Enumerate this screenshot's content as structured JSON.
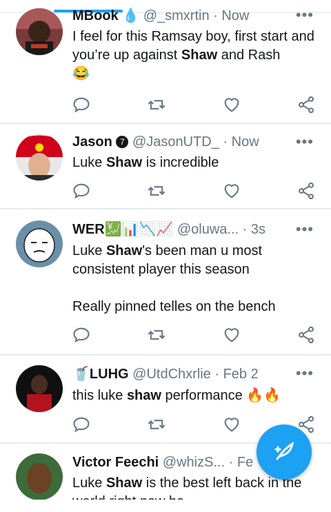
{
  "tweets": [
    {
      "name": "MBook",
      "handle_emoji": "💧",
      "handle": "@_smxrtin",
      "time": "· Now",
      "more": "•••",
      "text_before": "I feel for this Ramsay boy, first start and you’re up against ",
      "bold1": "Shaw",
      "text_mid": " and Rash",
      "emoji": "😂"
    },
    {
      "name": "Jason",
      "badge": "7",
      "handle": "@JasonUTD_",
      "time": "· Now",
      "more": "•••",
      "text_before": "Luke ",
      "bold1": "Shaw",
      "text_after": " is incredible"
    },
    {
      "name": "WER",
      "name_emoji": "💹📊📉📈",
      "handle": "@oluwa...",
      "time": "· 3s",
      "more": "•••",
      "text_before": "Luke ",
      "bold1": "Shaw",
      "text_after": "'s been man u most consistent player this season",
      "text_line2": "Really pinned telles on the bench"
    },
    {
      "name_emoji": "🥤",
      "name": "LUHG",
      "handle": "@UtdChxrlie",
      "time": "· Feb 2",
      "more": "•••",
      "text_before": "this luke ",
      "bold1": "shaw",
      "text_after": " performance ",
      "emoji": "🔥🔥"
    },
    {
      "name": "Victor Feechi",
      "handle": "@whizS...",
      "time": "· Fe",
      "more": "•••",
      "text_before": "Luke ",
      "bold1": "Shaw",
      "text_after": " is the best left back in the world right now ha..."
    }
  ],
  "colors": {
    "accent": "#1da1f2",
    "icon_gray": "#657786",
    "separator": "#e6ecf0"
  },
  "icons": [
    "reply-icon",
    "retweet-icon",
    "like-icon",
    "share-icon",
    "compose-tweet-icon",
    "more-options-icon"
  ]
}
